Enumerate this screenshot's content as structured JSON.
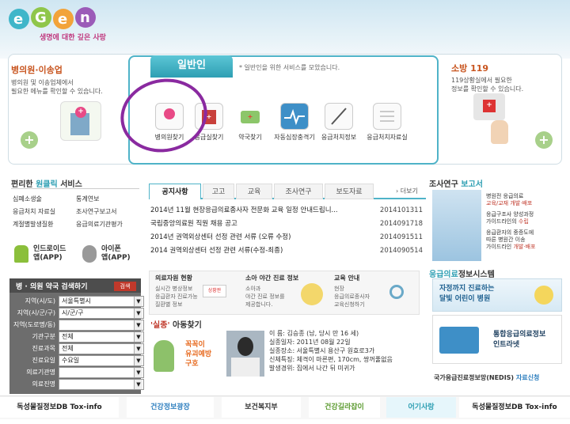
{
  "logo": {
    "text": "e·Gen",
    "tagline": "생명에 대한 깊은 사랑"
  },
  "left_panel": {
    "title": "병의원·이송업",
    "desc": [
      "병의원 및 이송업체에서",
      "필요한 메뉴를 확인할 수 있습니다."
    ]
  },
  "center_panel": {
    "tab": "일반인",
    "desc": "* 일반인을 위한 서비스를 모았습니다.",
    "services": [
      "병의원찾기",
      "응급실찾기",
      "약국찾기",
      "자동심장충격기",
      "응급처치정보",
      "응급처치자료실"
    ]
  },
  "right_panel": {
    "title": "소방 119",
    "desc": [
      "119상황실에서 필요한",
      "정보를 확인할 수 있습니다."
    ]
  },
  "quick": {
    "title_plain": "편리한",
    "title_colored": "원클릭",
    "title_rest": "서비스",
    "items": [
      "심폐소생술",
      "통계연보",
      "응급처치 자료실",
      "조사연구보고서",
      "계절별발생질환",
      "응급의료기관평가"
    ],
    "android": "인드로이드\n앱(APP)",
    "iphone": "아이폰\n앱(APP)"
  },
  "search": {
    "title": "병 · 의원 약국 검색하기",
    "button": "검색",
    "fields": [
      {
        "label": "지역(시/도)",
        "value": "서울특별시"
      },
      {
        "label": "지역(시/군/구)",
        "value": "시/군/구"
      },
      {
        "label": "지역(도로명/동)",
        "value": ""
      },
      {
        "label": "기관구분",
        "value": "전체"
      },
      {
        "label": "진료과목",
        "value": "전체"
      },
      {
        "label": "진료요일",
        "value": "수요일"
      },
      {
        "label": "의료기관명",
        "value": ""
      },
      {
        "label": "의료진명",
        "value": ""
      }
    ]
  },
  "notice": {
    "tabs": [
      "공지사항",
      "고고",
      "교육",
      "조사연구",
      "보도자료"
    ],
    "more": "› 더보기",
    "rows": [
      {
        "title": "2014년 11월 현장응급의료종사자 전문화 교육 일정 안내드립니...",
        "date": "2014101311"
      },
      {
        "title": "국립중앙의료원 직원 채용 공고",
        "date": "2014091718"
      },
      {
        "title": "2014년 권역외상센터 선정 관련 서류 (오류 수정)",
        "date": "2014091511"
      },
      {
        "title": "2014 권역외상센터 선정 관련 서류(수정-최종)",
        "date": "2014090514"
      }
    ]
  },
  "info_cards": [
    {
      "title": "의료자원 현황",
      "text": "실시간 병상정보\n응급환자 진료가능\n질환별 정보",
      "badge": "상황판"
    },
    {
      "title": "소아 야간 진료 정보",
      "text": "소아과\n야간 진료 정보를\n제공합니다."
    },
    {
      "title": "교육 안내",
      "text": "현장\n응급의료종사자\n교육신청하기"
    }
  ],
  "missing": {
    "title_red": "'실종'",
    "title_rest": "아동찾기",
    "sticker": "꼭꼭이\n유괴예방\n구호",
    "lines": [
      "이 름: 김승종 (남, 당시 만 16 세)",
      "실종일자: 2011년 08월 22일",
      "실종장소: 서울특별시 용산구 원효로3가",
      "신체특징: 체격이 마른편, 170cm, 쌍꺼풀없음",
      "발생경위: 집에서 나간 뒤 미귀가"
    ]
  },
  "research": {
    "title_plain": "조사연구",
    "title_colored": "보고서",
    "items": [
      {
        "text": "병원전 응급의료",
        "hl": "교육/교재 개발·배포"
      },
      {
        "text": "응급구조사 양성과정\n가이드라인의",
        "hl": "수립"
      },
      {
        "text": "응급환자의 중증도에\n따른 병원간 이송\n가이드라인",
        "hl": "개발·배포"
      }
    ]
  },
  "emergency": {
    "title_colored": "응급의료",
    "title_plain": "정보시스템",
    "banner1": "자정까지 진료하는\n달빛 어린이 병원",
    "banner2": "통합응급의료정보\n인트라넷",
    "nedis": "국가응급진료정보망(NEDIS)",
    "nedis_link": "자료신청"
  },
  "bottom": [
    "독성물질정보DB Tox-info",
    "건강정보광장",
    "보건복지부",
    "건강길라잡이",
    "어기사랑",
    "독성물질정보DB Tox-info"
  ]
}
